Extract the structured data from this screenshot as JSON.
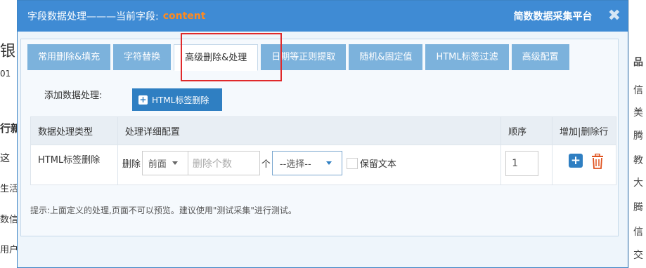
{
  "background": {
    "left_fragments": [
      "银",
      "01",
      "行新",
      "这",
      "生活",
      "数信",
      "用户"
    ],
    "right_fragments": [
      "品",
      "信",
      "美",
      "腾",
      "教",
      "大",
      "腾",
      "信",
      "交"
    ]
  },
  "dialog": {
    "title_prefix": "字段数据处理———当前字段:",
    "title_field": "content",
    "platform": "简数数据采集平台",
    "close_glyph": "✖"
  },
  "tabs": [
    {
      "label": "常用删除&填充",
      "active": false
    },
    {
      "label": "字符替换",
      "active": false
    },
    {
      "label": "高级删除&处理",
      "active": true
    },
    {
      "label": "日期等正则提取",
      "active": false
    },
    {
      "label": "随机&固定值",
      "active": false
    },
    {
      "label": "HTML标签过滤",
      "active": false
    },
    {
      "label": "高级配置",
      "active": false
    }
  ],
  "add_section": {
    "label": "添加数据处理:",
    "button_label": "HTML标签删除"
  },
  "table": {
    "headers": [
      "数据处理类型",
      "处理详细配置",
      "顺序",
      "增加|删除行"
    ],
    "row": {
      "type": "HTML标签删除",
      "delete_label": "删除",
      "position_value": "前面",
      "count_placeholder": "删除个数",
      "unit": "个",
      "select_value": "--选择--",
      "keep_text_label": "保留文本",
      "order_value": "1"
    }
  },
  "tip": "提示:上面定义的处理,页面不可以预览。建议使用\"测试采集\"进行测试。",
  "colors": {
    "titlebar": "#3f8bd4",
    "field_highlight": "#ff8a1f",
    "tab_inactive": "#7cb2dc",
    "primary_button": "#2f7fc2",
    "delete_icon": "#e0521e",
    "annotation_box": "#e0292b"
  }
}
